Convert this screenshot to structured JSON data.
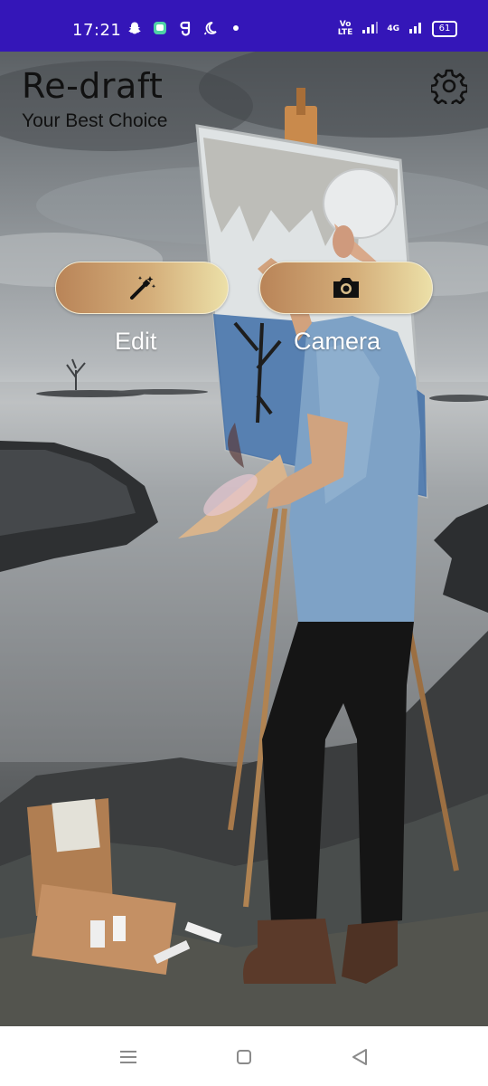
{
  "status_bar": {
    "time": "17:21",
    "left_icons": [
      "snapchat-icon",
      "messages-icon",
      "g-icon",
      "moon-icon",
      "dot-icon"
    ],
    "volte_label_top": "Vo",
    "volte_label_bottom": "LTE",
    "network_label": "4G",
    "battery": "61"
  },
  "header": {
    "title": "Re-draft",
    "subtitle": "Your Best Choice",
    "settings_icon": "gear-icon"
  },
  "actions": {
    "edit_label": "Edit",
    "edit_icon": "magic-wand-icon",
    "camera_label": "Camera",
    "camera_icon": "camera-icon"
  },
  "nav_bar": {
    "icons": [
      "menu-icon",
      "home-icon",
      "back-icon"
    ]
  },
  "colors": {
    "status_bar_bg": "#3416b8",
    "button_gradient_start": "#b98458",
    "button_gradient_end": "#ece0a8",
    "label_text": "#ffffff",
    "title_text": "#111111"
  }
}
